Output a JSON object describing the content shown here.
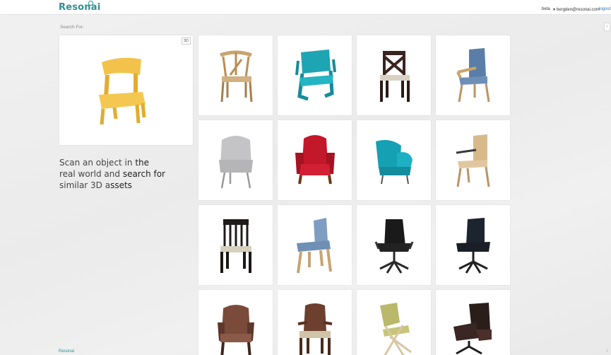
{
  "header": {
    "logo": "Resonai",
    "beta": "beta",
    "email": "bergden@resonai.com",
    "logout": "logout",
    "brand_color": "#2f8f94"
  },
  "search": {
    "label": "Search For:",
    "badge": "3D"
  },
  "tagline": {
    "p1": "Scan an object in ",
    "b1": "the",
    "p2": "real world and ",
    "b2": "search for",
    "p3": "similar 3D a",
    "b3": "ssets"
  },
  "results": [
    "wooden-wishbone-chair-icon",
    "teal-tube-chair-icon",
    "dark-cross-back-chair-icon",
    "blue-armchair-icon",
    "grey-fabric-armchair-icon",
    "red-baroque-armchair-icon",
    "teal-lounge-chair-icon",
    "tan-armchair-icon",
    "black-upholstered-chair-icon",
    "blue-stool-chair-icon",
    "black-office-chair-icon",
    "black-office-chair-icon",
    "brown-armchair-icon",
    "wooden-armchair-icon",
    "lime-folding-chair-icon",
    "black-lounge-chair-icon"
  ],
  "footer": {
    "brand": "Resonai"
  }
}
